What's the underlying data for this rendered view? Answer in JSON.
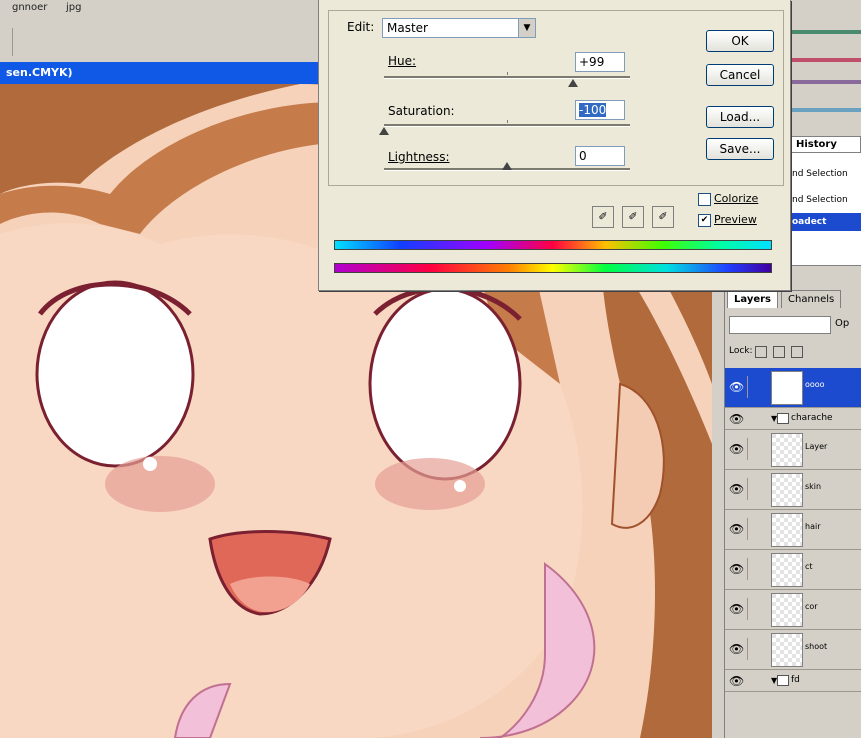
{
  "menubar": {
    "items": [
      "gnnoer",
      "jpg"
    ]
  },
  "document": {
    "title": "sen.CMYK)"
  },
  "dialog": {
    "edit_label": "Edit:",
    "edit_value": "Master",
    "hue_label": "Hue:",
    "hue_value": "+99",
    "saturation_label": "Saturation:",
    "saturation_value": "-100",
    "lightness_label": "Lightness:",
    "lightness_value": "0",
    "buttons": {
      "ok": "OK",
      "cancel": "Cancel",
      "load": "Load...",
      "save": "Save..."
    },
    "colorize_label": "Colorize",
    "colorize_checked": false,
    "preview_label": "Preview",
    "preview_checked": true,
    "sliders": {
      "hue": 0.77,
      "saturation": 0.0,
      "lightness": 0.5
    }
  },
  "history": {
    "tab": "History",
    "items": [
      {
        "label": "nd Selection",
        "selected": false
      },
      {
        "label": "nd Selection",
        "selected": false
      },
      {
        "label": "oadect",
        "selected": true
      }
    ]
  },
  "layers": {
    "tabs": [
      "Layers",
      "Channels"
    ],
    "lock_label": "Lock:",
    "opacity_label": "Op",
    "items": [
      {
        "name": "oooo",
        "selected": true,
        "folder": false
      },
      {
        "name": "charache",
        "selected": false,
        "folder": true
      },
      {
        "name": "Layer",
        "selected": false,
        "folder": false
      },
      {
        "name": "skin",
        "selected": false,
        "folder": false
      },
      {
        "name": "hair",
        "selected": false,
        "folder": false
      },
      {
        "name": "ct",
        "selected": false,
        "folder": false
      },
      {
        "name": "cor",
        "selected": false,
        "folder": false
      },
      {
        "name": "shoot",
        "selected": false,
        "folder": false
      },
      {
        "name": "fd",
        "selected": false,
        "folder": true
      }
    ]
  },
  "colors": {
    "titlebar": "#1059e6",
    "skin": "#f6d2ba",
    "hair": "#b06a3c",
    "selection": "#1c4bd0"
  }
}
